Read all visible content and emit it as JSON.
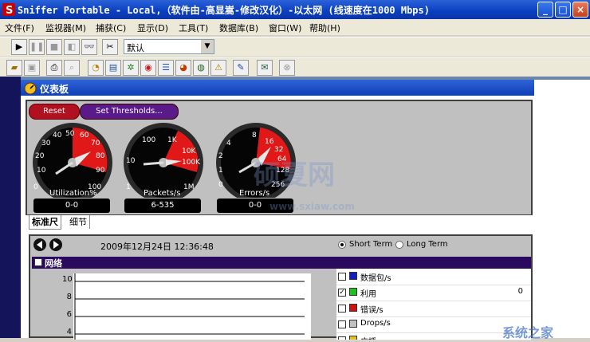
{
  "window": {
    "title": "Sniffer Portable - Local,（软件由-高显嵩-修改汉化）-以太网 (线速度在1000 Mbps)",
    "controls": [
      "_",
      "□",
      "×"
    ]
  },
  "menu": [
    "文件(F)",
    "监视器(M)",
    "捕获(C)",
    "显示(D)",
    "工具(T)",
    "数据库(B)",
    "窗口(W)",
    "帮助(H)"
  ],
  "toolbar": {
    "profile_value": "默认"
  },
  "dashboard": {
    "title": "仪表板",
    "reset_label": "Reset",
    "thresholds_label": "Set Thresholds...",
    "gauges": [
      {
        "name": "Utilization%",
        "value_text": "0-0",
        "ticks": [
          "0",
          "10",
          "20",
          "30",
          "40",
          "50",
          "60",
          "70",
          "80",
          "90",
          "100"
        ],
        "needle_fraction": 0.0
      },
      {
        "name": "Packets/s",
        "value_text": "6-535",
        "ticks": [
          "1",
          "10",
          "100",
          "1K",
          "10K",
          "100K",
          "1M"
        ],
        "needle_fraction": 0.0
      },
      {
        "name": "Errors/s",
        "value_text": "0-0",
        "ticks": [
          "0",
          "1",
          "2",
          "4",
          "8",
          "16",
          "32",
          "64",
          "128",
          "256"
        ],
        "needle_fraction": 0.0
      }
    ],
    "tabs": [
      "标准尺",
      "细节"
    ]
  },
  "history": {
    "timestamp": "2009年12月24日  12:36:48",
    "short_term": "Short Term",
    "long_term": "Long Term",
    "section": "网络",
    "y_ticks": [
      "10",
      "8",
      "6",
      "4"
    ],
    "legend": [
      {
        "label": "数据包/s",
        "color": "#1020c0",
        "checked": false,
        "value": ""
      },
      {
        "label": "利用",
        "color": "#20c020",
        "checked": true,
        "value": "0"
      },
      {
        "label": "错误/s",
        "color": "#d01010",
        "checked": false,
        "value": ""
      },
      {
        "label": "Drops/s",
        "color": "#c0c0c0",
        "checked": false,
        "value": ""
      },
      {
        "label": "广播",
        "color": "#e0c020",
        "checked": false,
        "value": ""
      }
    ]
  },
  "watermark": {
    "text1": "硕夏网",
    "text2": "www.sxiaw.com",
    "text3": "系统之家"
  }
}
